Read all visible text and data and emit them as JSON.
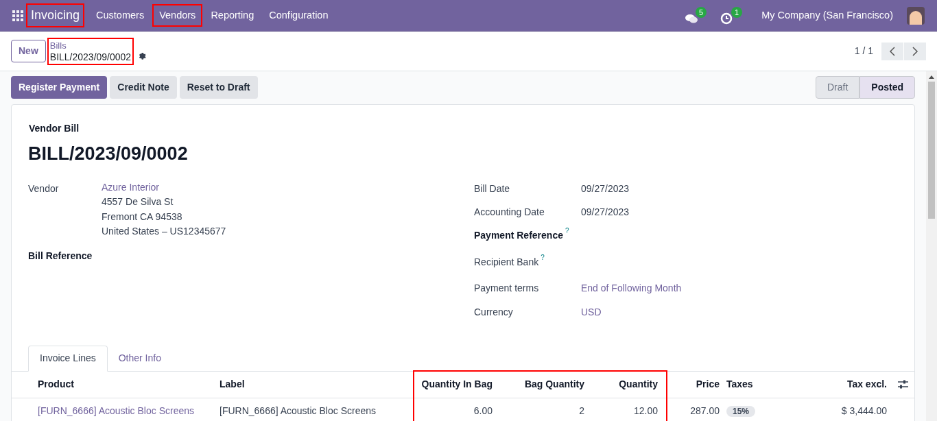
{
  "navbar": {
    "app": {
      "label": "Invoicing",
      "highlighted": true
    },
    "menu": [
      {
        "label": "Customers",
        "highlighted": false
      },
      {
        "label": "Vendors",
        "highlighted": true
      },
      {
        "label": "Reporting",
        "highlighted": false
      },
      {
        "label": "Configuration",
        "highlighted": false
      }
    ],
    "messages_badge": "5",
    "activities_badge": "1",
    "company": "My Company (San Francisco)"
  },
  "control_panel": {
    "new_button": "New",
    "breadcrumb": {
      "parent": "Bills",
      "current": "BILL/2023/09/0002",
      "highlighted": true
    },
    "pager": "1 / 1"
  },
  "actions": [
    {
      "label": "Register Payment",
      "kind": "primary"
    },
    {
      "label": "Credit Note",
      "kind": "secondary"
    },
    {
      "label": "Reset to Draft",
      "kind": "secondary"
    }
  ],
  "statusbar": [
    {
      "label": "Draft",
      "selected": false
    },
    {
      "label": "Posted",
      "selected": true
    }
  ],
  "form": {
    "type_label": "Vendor Bill",
    "number": "BILL/2023/09/0002",
    "vendor": {
      "label": "Vendor",
      "name": "Azure Interior",
      "address": [
        "4557 De Silva St",
        "Fremont CA 94538",
        "United States – US12345677"
      ]
    },
    "bill_reference": {
      "label": "Bill Reference"
    },
    "right_fields": [
      {
        "label": "Bill Date",
        "value": "09/27/2023",
        "kind": "plain"
      },
      {
        "label": "Accounting Date",
        "value": "09/27/2023",
        "kind": "plain"
      },
      {
        "label": "Payment Reference",
        "help": "?",
        "kind": "bold"
      },
      {
        "label": "Recipient Bank",
        "help": "?",
        "kind": "plain"
      },
      {
        "label": "Payment terms",
        "value": "End of Following Month",
        "kind": "link"
      },
      {
        "label": "Currency",
        "value": "USD",
        "kind": "link"
      }
    ]
  },
  "tabs": [
    {
      "label": "Invoice Lines",
      "selected": true
    },
    {
      "label": "Other Info",
      "selected": false
    }
  ],
  "table": {
    "columns": [
      {
        "label": "Product",
        "highlighted": false
      },
      {
        "label": "Label",
        "highlighted": false
      },
      {
        "label": "Quantity In Bag",
        "highlighted": true
      },
      {
        "label": "Bag Quantity",
        "highlighted": true
      },
      {
        "label": "Quantity",
        "highlighted": true
      },
      {
        "label": "Price",
        "highlighted": false
      },
      {
        "label": "Taxes",
        "highlighted": false
      },
      {
        "label": "Tax excl.",
        "highlighted": false
      }
    ],
    "rows": [
      {
        "product": "[FURN_6666] Acoustic Bloc Screens",
        "label": "[FURN_6666] Acoustic Bloc Screens",
        "quantity_in_bag": "6.00",
        "bag_quantity": "2",
        "quantity": "12.00",
        "price": "287.00",
        "taxes": "15%",
        "tax_excl": "$ 3,444.00"
      }
    ]
  }
}
